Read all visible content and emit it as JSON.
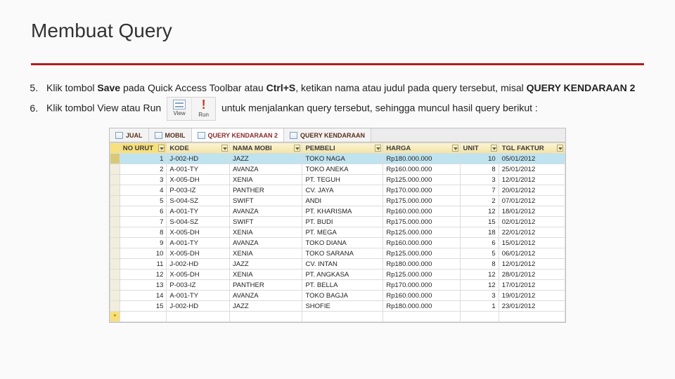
{
  "title": "Membuat Query",
  "steps": {
    "n5_a": "Klik tombol ",
    "n5_b": "Save",
    "n5_c": " pada Quick Access Toolbar atau ",
    "n5_d": "Ctrl+S",
    "n5_e": ", ketikan nama atau judul pada query tersebut, misal ",
    "n5_f": "QUERY KENDARAAN 2",
    "n6_a": "Klik tombol View atau Run ",
    "n6_b": " untuk menjalankan query tersebut, sehingga muncul hasil query berikut :",
    "view_label": "View",
    "run_label": "Run"
  },
  "tabs": [
    {
      "label": "JUAL",
      "active": false
    },
    {
      "label": "MOBIL",
      "active": false
    },
    {
      "label": "QUERY KENDARAAN 2",
      "active": true
    },
    {
      "label": "QUERY KENDARAAN",
      "active": false
    }
  ],
  "columns": [
    "NO URUT",
    "KODE",
    "NAMA MOBI",
    "PEMBELI",
    "HARGA",
    "UNIT",
    "TGL FAKTUR"
  ],
  "rows": [
    {
      "n": 1,
      "kode": "J-002-HD",
      "nama": "JAZZ",
      "pembeli": "TOKO NAGA",
      "harga": "Rp180.000.000",
      "unit": 10,
      "tgl": "05/01/2012",
      "sel": true
    },
    {
      "n": 2,
      "kode": "A-001-TY",
      "nama": "AVANZA",
      "pembeli": "TOKO ANEKA",
      "harga": "Rp160.000.000",
      "unit": 8,
      "tgl": "25/01/2012"
    },
    {
      "n": 3,
      "kode": "X-005-DH",
      "nama": "XENIA",
      "pembeli": "PT. TEGUH",
      "harga": "Rp125.000.000",
      "unit": 3,
      "tgl": "12/01/2012"
    },
    {
      "n": 4,
      "kode": "P-003-IZ",
      "nama": "PANTHER",
      "pembeli": "CV. JAYA",
      "harga": "Rp170.000.000",
      "unit": 7,
      "tgl": "20/01/2012"
    },
    {
      "n": 5,
      "kode": "S-004-SZ",
      "nama": "SWIFT",
      "pembeli": "ANDI",
      "harga": "Rp175.000.000",
      "unit": 2,
      "tgl": "07/01/2012"
    },
    {
      "n": 6,
      "kode": "A-001-TY",
      "nama": "AVANZA",
      "pembeli": "PT. KHARISMA",
      "harga": "Rp160.000.000",
      "unit": 12,
      "tgl": "18/01/2012"
    },
    {
      "n": 7,
      "kode": "S-004-SZ",
      "nama": "SWIFT",
      "pembeli": "PT. BUDI",
      "harga": "Rp175.000.000",
      "unit": 15,
      "tgl": "02/01/2012"
    },
    {
      "n": 8,
      "kode": "X-005-DH",
      "nama": "XENIA",
      "pembeli": "PT. MEGA",
      "harga": "Rp125.000.000",
      "unit": 18,
      "tgl": "22/01/2012"
    },
    {
      "n": 9,
      "kode": "A-001-TY",
      "nama": "AVANZA",
      "pembeli": "TOKO DIANA",
      "harga": "Rp160.000.000",
      "unit": 6,
      "tgl": "15/01/2012"
    },
    {
      "n": 10,
      "kode": "X-005-DH",
      "nama": "XENIA",
      "pembeli": "TOKO SARANA",
      "harga": "Rp125.000.000",
      "unit": 5,
      "tgl": "06/01/2012"
    },
    {
      "n": 11,
      "kode": "J-002-HD",
      "nama": "JAZZ",
      "pembeli": "CV. INTAN",
      "harga": "Rp180.000.000",
      "unit": 8,
      "tgl": "12/01/2012"
    },
    {
      "n": 12,
      "kode": "X-005-DH",
      "nama": "XENIA",
      "pembeli": "PT. ANGKASA",
      "harga": "Rp125.000.000",
      "unit": 12,
      "tgl": "28/01/2012"
    },
    {
      "n": 13,
      "kode": "P-003-IZ",
      "nama": "PANTHER",
      "pembeli": "PT. BELLA",
      "harga": "Rp170.000.000",
      "unit": 12,
      "tgl": "17/01/2012"
    },
    {
      "n": 14,
      "kode": "A-001-TY",
      "nama": "AVANZA",
      "pembeli": "TOKO BAGJA",
      "harga": "Rp160.000.000",
      "unit": 3,
      "tgl": "19/01/2012"
    },
    {
      "n": 15,
      "kode": "J-002-HD",
      "nama": "JAZZ",
      "pembeli": "SHOFIE",
      "harga": "Rp180.000.000",
      "unit": 1,
      "tgl": "23/01/2012"
    }
  ]
}
